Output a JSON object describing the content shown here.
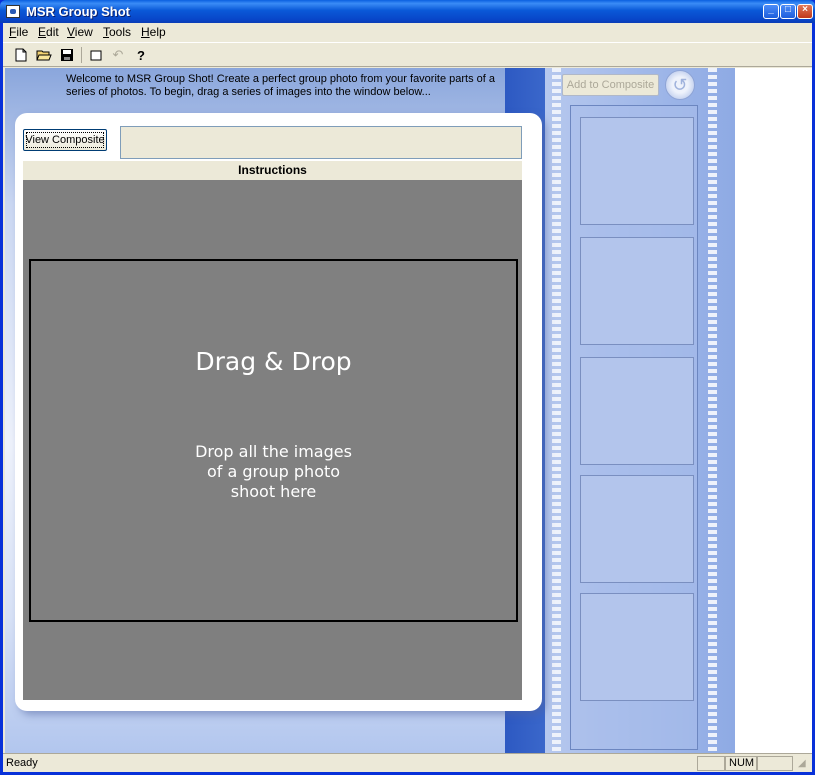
{
  "window": {
    "title": "MSR Group Shot"
  },
  "menu": [
    {
      "key": "F",
      "rest": "ile"
    },
    {
      "key": "E",
      "rest": "dit"
    },
    {
      "key": "V",
      "rest": "iew"
    },
    {
      "key": "T",
      "rest": "ools"
    },
    {
      "key": "H",
      "rest": "elp"
    }
  ],
  "toolbar": {
    "icons": [
      "new-document-icon",
      "open-folder-icon",
      "save-icon",
      "select-rectangle-icon",
      "undo-icon",
      "help-icon"
    ]
  },
  "welcome_text": "Welcome to MSR Group Shot! Create a perfect group photo from your favorite parts of a series of photos. To begin, drag a series of images into the window below...",
  "buttons": {
    "view_composite": "View Composite",
    "add_to_composite": "Add to Composite"
  },
  "instructions_header": "Instructions",
  "dropzone": {
    "title": "Drag & Drop",
    "subtitle": "Drop all the images\nof a group photo\nshoot here"
  },
  "status": {
    "text": "Ready",
    "num": "NUM"
  }
}
